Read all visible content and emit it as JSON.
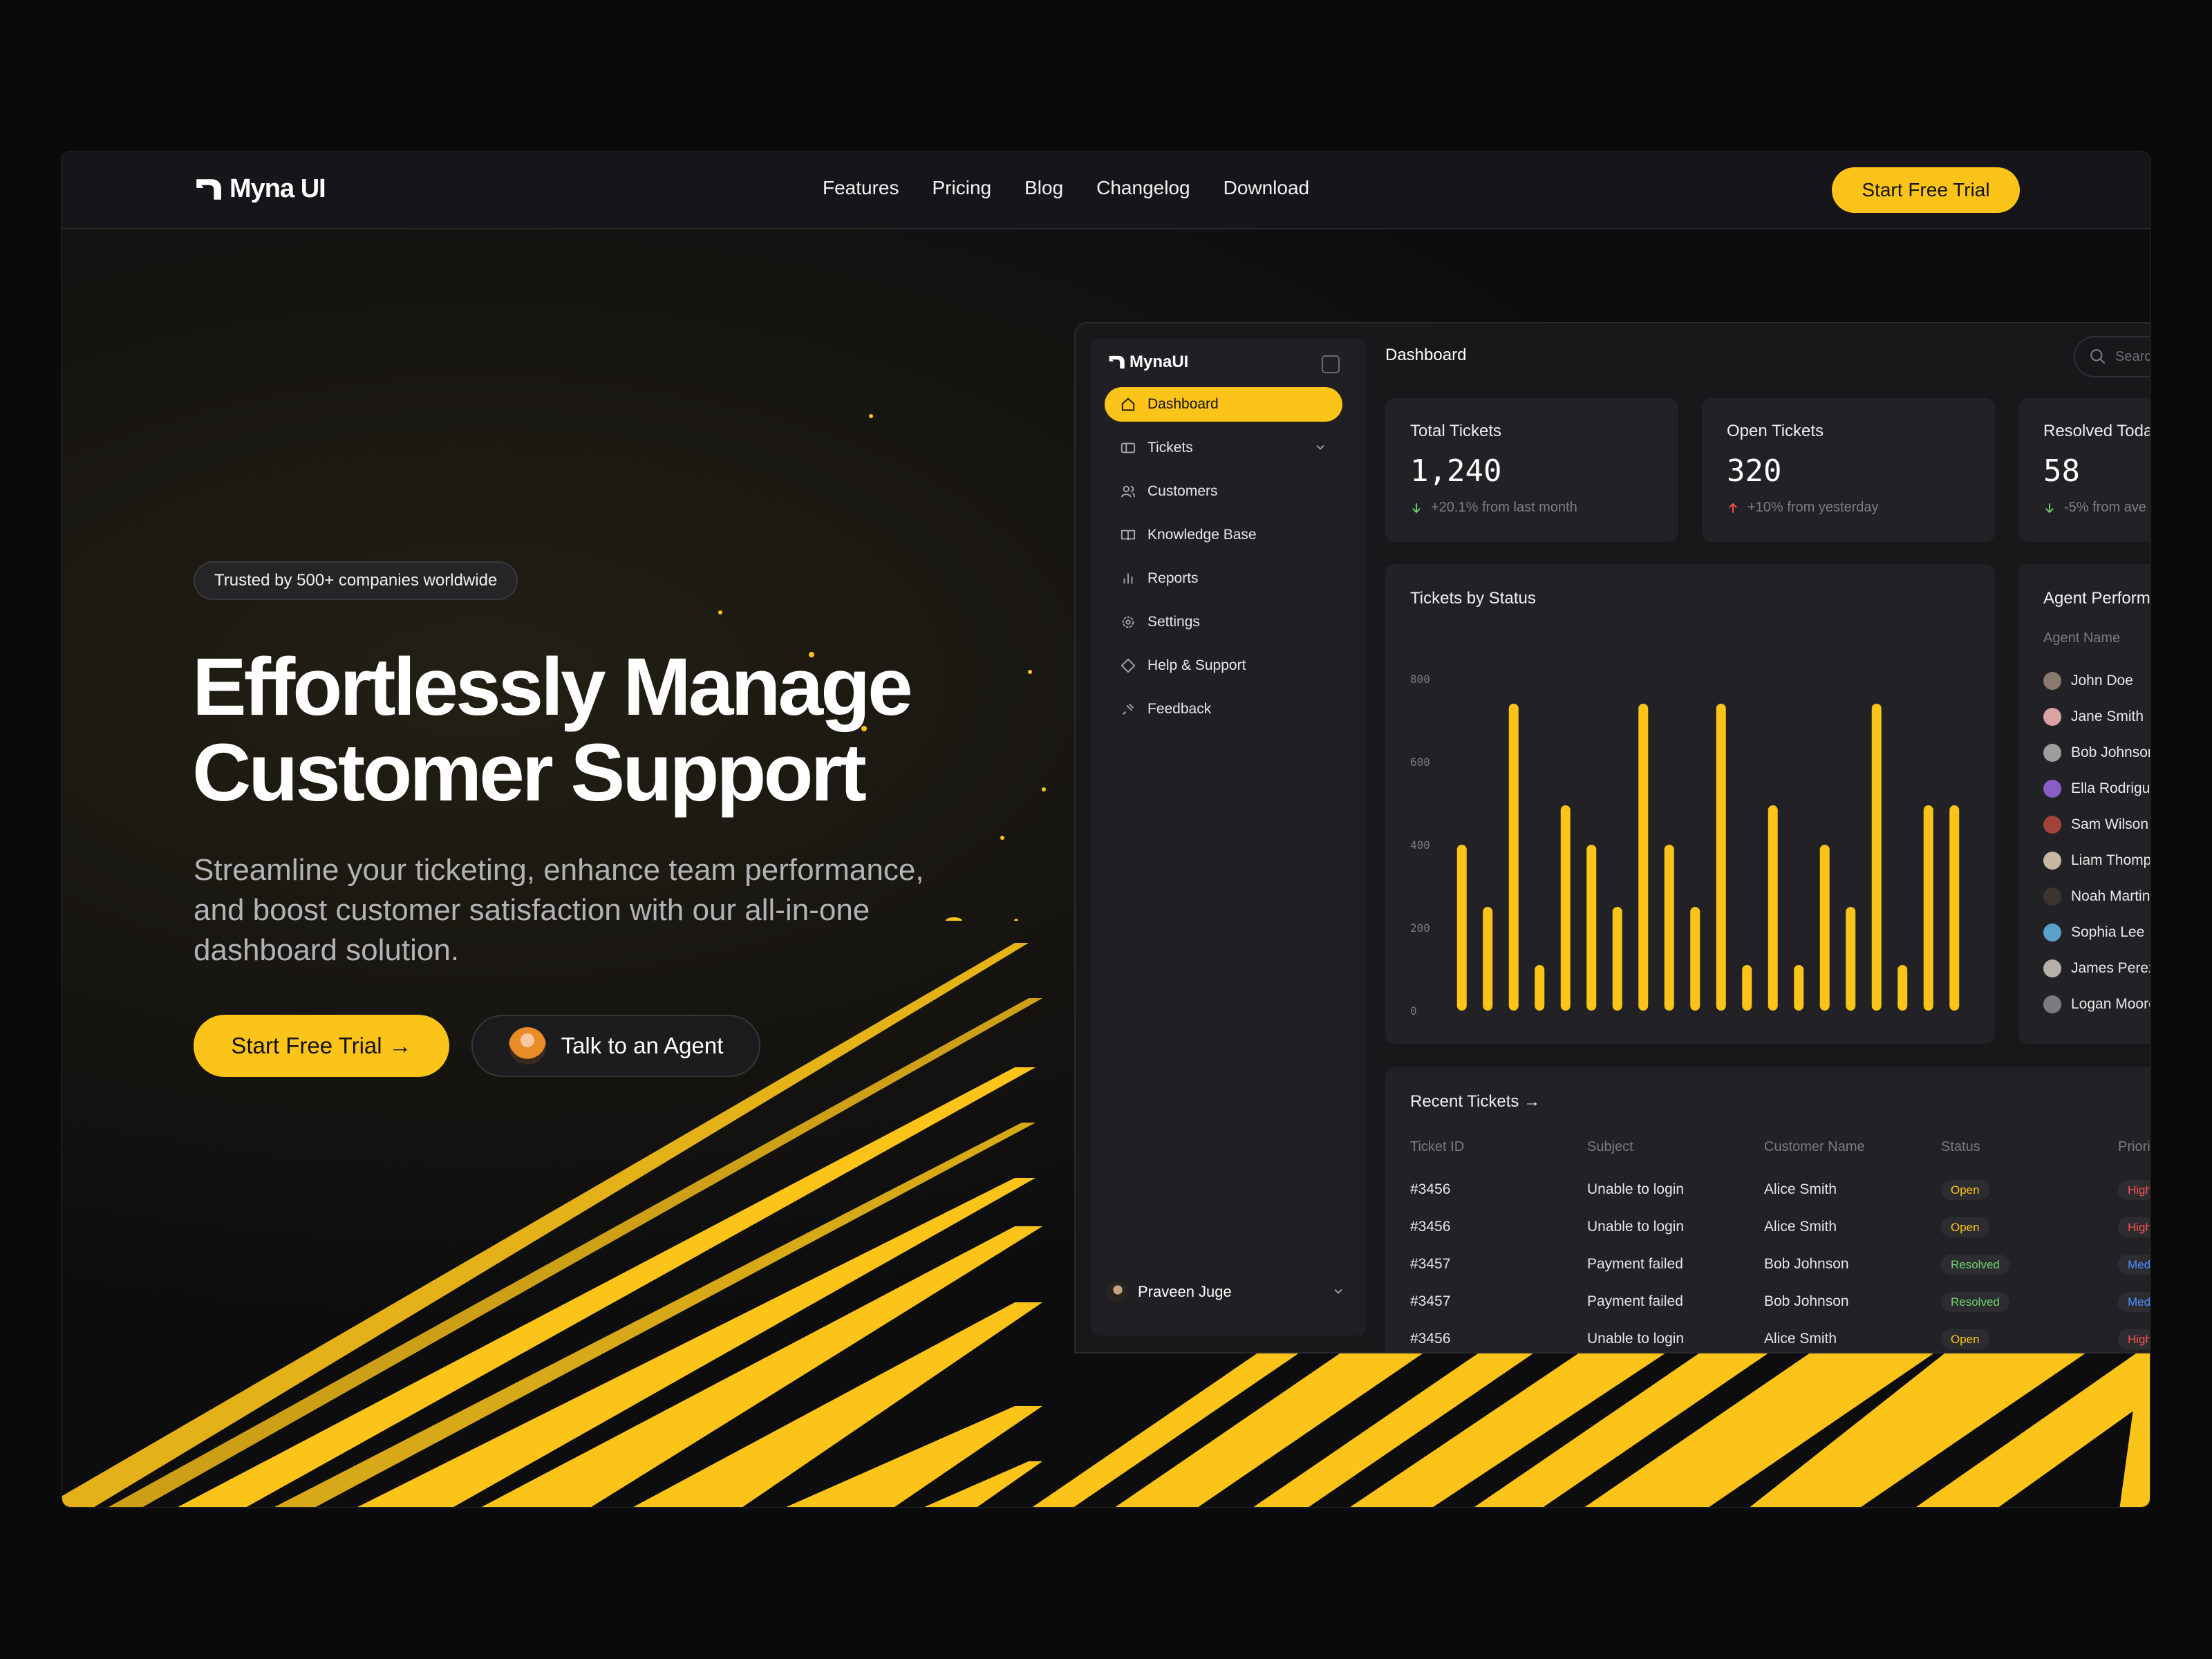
{
  "nav": {
    "brand": "Myna UI",
    "links": [
      "Features",
      "Pricing",
      "Blog",
      "Changelog",
      "Download"
    ],
    "cta": "Start Free Trial"
  },
  "hero": {
    "badge": "Trusted by 500+ companies worldwide",
    "headline_1": "Effortlessly Manage",
    "headline_2": "Customer Support",
    "subtext": "Streamline your ticketing, enhance team performance, and boost customer satisfaction with our all-in-one dashboard solution.",
    "cta_primary": "Start Free Trial",
    "cta_primary_icon": "→",
    "cta_secondary": "Talk to an Agent"
  },
  "dashboard": {
    "brand": "MynaUI",
    "title": "Dashboard",
    "search_placeholder": "Search tickets,",
    "sidebar": [
      {
        "label": "Dashboard",
        "icon": "home-icon",
        "active": true
      },
      {
        "label": "Tickets",
        "icon": "ticket-icon",
        "expandable": true
      },
      {
        "label": "Customers",
        "icon": "users-icon"
      },
      {
        "label": "Knowledge Base",
        "icon": "book-icon"
      },
      {
        "label": "Reports",
        "icon": "bar-chart-icon"
      },
      {
        "label": "Settings",
        "icon": "gear-icon"
      },
      {
        "label": "Help & Support",
        "icon": "help-icon"
      },
      {
        "label": "Feedback",
        "icon": "feedback-icon"
      }
    ],
    "user": "Praveen Juge",
    "stats": [
      {
        "label": "Total Tickets",
        "value": "1,240",
        "change": "+20.1% from last month",
        "trend": "down"
      },
      {
        "label": "Open Tickets",
        "value": "320",
        "change": "+10% from yesterday",
        "trend": "up"
      },
      {
        "label": "Resolved Toda",
        "value": "58",
        "change": "-5% from ave",
        "trend": "down"
      }
    ],
    "chart_title": "Tickets by Status",
    "agents_title": "Agent Perform",
    "agents_header": "Agent Name",
    "agents": [
      "John Doe",
      "Jane Smith",
      "Bob Johnson",
      "Ella Rodrigue",
      "Sam Wilson",
      "Liam Thomp",
      "Noah Martin",
      "Sophia Lee",
      "James Perez",
      "Logan Moore"
    ],
    "recent_title": "Recent Tickets →",
    "table_headers": [
      "Ticket ID",
      "Subject",
      "Customer Name",
      "Status",
      "Priori"
    ],
    "tickets": [
      {
        "id": "#3456",
        "subject": "Unable to login",
        "customer": "Alice Smith",
        "status": "Open",
        "priority": "High"
      },
      {
        "id": "#3456",
        "subject": "Unable to login",
        "customer": "Alice Smith",
        "status": "Open",
        "priority": "High"
      },
      {
        "id": "#3457",
        "subject": "Payment failed",
        "customer": "Bob Johnson",
        "status": "Resolved",
        "priority": "Medi"
      },
      {
        "id": "#3457",
        "subject": "Payment failed",
        "customer": "Bob Johnson",
        "status": "Resolved",
        "priority": "Medi"
      },
      {
        "id": "#3456",
        "subject": "Unable to login",
        "customer": "Alice Smith",
        "status": "Open",
        "priority": "High"
      }
    ]
  },
  "colors": {
    "accent": "#fcc419",
    "panel": "#222226",
    "background": "#0d0d0e"
  },
  "chart_data": {
    "type": "bar",
    "title": "Tickets by Status",
    "xlabel": "",
    "ylabel": "",
    "ylim": [
      0,
      800
    ],
    "yticks": [
      0,
      200,
      400,
      600,
      800
    ],
    "values": [
      400,
      250,
      740,
      110,
      495,
      400,
      250,
      740,
      400,
      250,
      740,
      110,
      495,
      110,
      400,
      250,
      740,
      110,
      495,
      495
    ],
    "grid": false
  }
}
